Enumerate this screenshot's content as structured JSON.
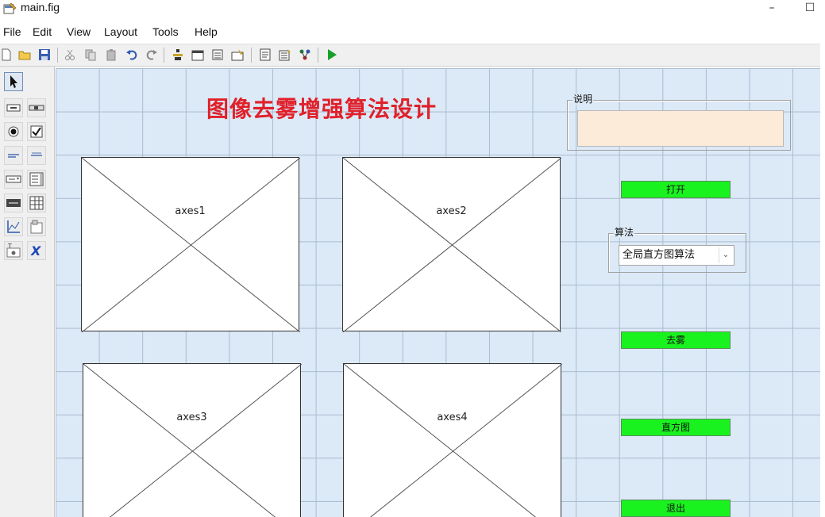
{
  "window": {
    "title": "main.fig",
    "minimize_label": "–",
    "maximize_label": "☐"
  },
  "menu": {
    "items": [
      "File",
      "Edit",
      "View",
      "Layout",
      "Tools",
      "Help"
    ]
  },
  "toolbar": {
    "icons": [
      "new-file-icon",
      "open-folder-icon",
      "save-icon",
      "cut-icon",
      "copy-icon",
      "paste-icon",
      "undo-icon",
      "redo-icon",
      "align-icon",
      "menu-editor-icon",
      "tab-order-icon",
      "toolbar-editor-icon",
      "editor-icon",
      "property-inspector-icon",
      "object-browser-icon",
      "run-icon"
    ]
  },
  "palette": {
    "tools": [
      "select-tool-icon",
      "push-button-tool-icon",
      "slider-tool-icon",
      "radio-button-tool-icon",
      "checkbox-tool-icon",
      "edit-text-tool-icon",
      "static-text-tool-icon",
      "popup-menu-tool-icon",
      "listbox-tool-icon",
      "toggle-button-tool-icon",
      "table-tool-icon",
      "axes-tool-icon",
      "panel-tool-icon",
      "button-group-tool-icon",
      "activex-tool-icon"
    ]
  },
  "figure": {
    "title": "图像去雾增强算法设计",
    "description_panel_title": "说明",
    "description_text": "",
    "axes": [
      {
        "label": "axes1"
      },
      {
        "label": "axes2"
      },
      {
        "label": "axes3"
      },
      {
        "label": "axes4"
      }
    ],
    "buttons": {
      "open": "打开",
      "dehaze": "去雾",
      "histogram": "直方图",
      "exit": "退出"
    },
    "algorithm_panel_title": "算法",
    "algorithm_select_value": "全局直方图算法",
    "colors": {
      "button_green": "#19f21f",
      "title_red": "#e0202a",
      "canvas_bg": "#dce9f7",
      "textbox_bg": "#fdebd9"
    }
  }
}
